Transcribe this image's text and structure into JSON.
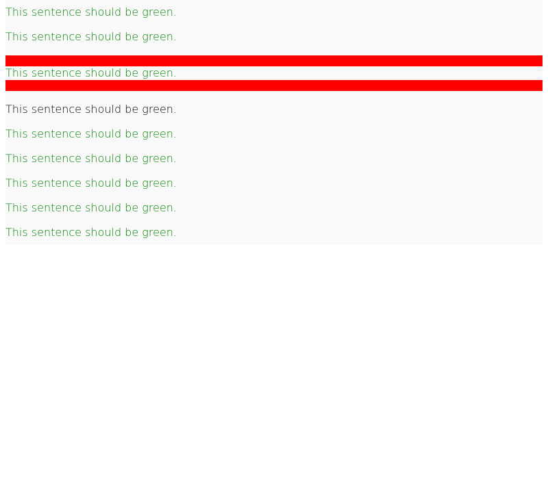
{
  "colors": {
    "green": "#008000",
    "black": "#000000",
    "red": "#ff0000",
    "panel": "#f9f9f9"
  },
  "lines": [
    {
      "text": "This sentence should be green.",
      "color": "green"
    },
    {
      "text": "This sentence should be green.",
      "color": "green"
    },
    {
      "text": "This sentence should be green.",
      "color": "green"
    },
    {
      "text": "This sentence should be green.",
      "color": "black"
    },
    {
      "text": "This sentence should be green.",
      "color": "green"
    },
    {
      "text": "This sentence should be green.",
      "color": "green"
    },
    {
      "text": "This sentence should be green.",
      "color": "green"
    },
    {
      "text": "This sentence should be green.",
      "color": "green"
    },
    {
      "text": "This sentence should be green.",
      "color": "green"
    }
  ]
}
